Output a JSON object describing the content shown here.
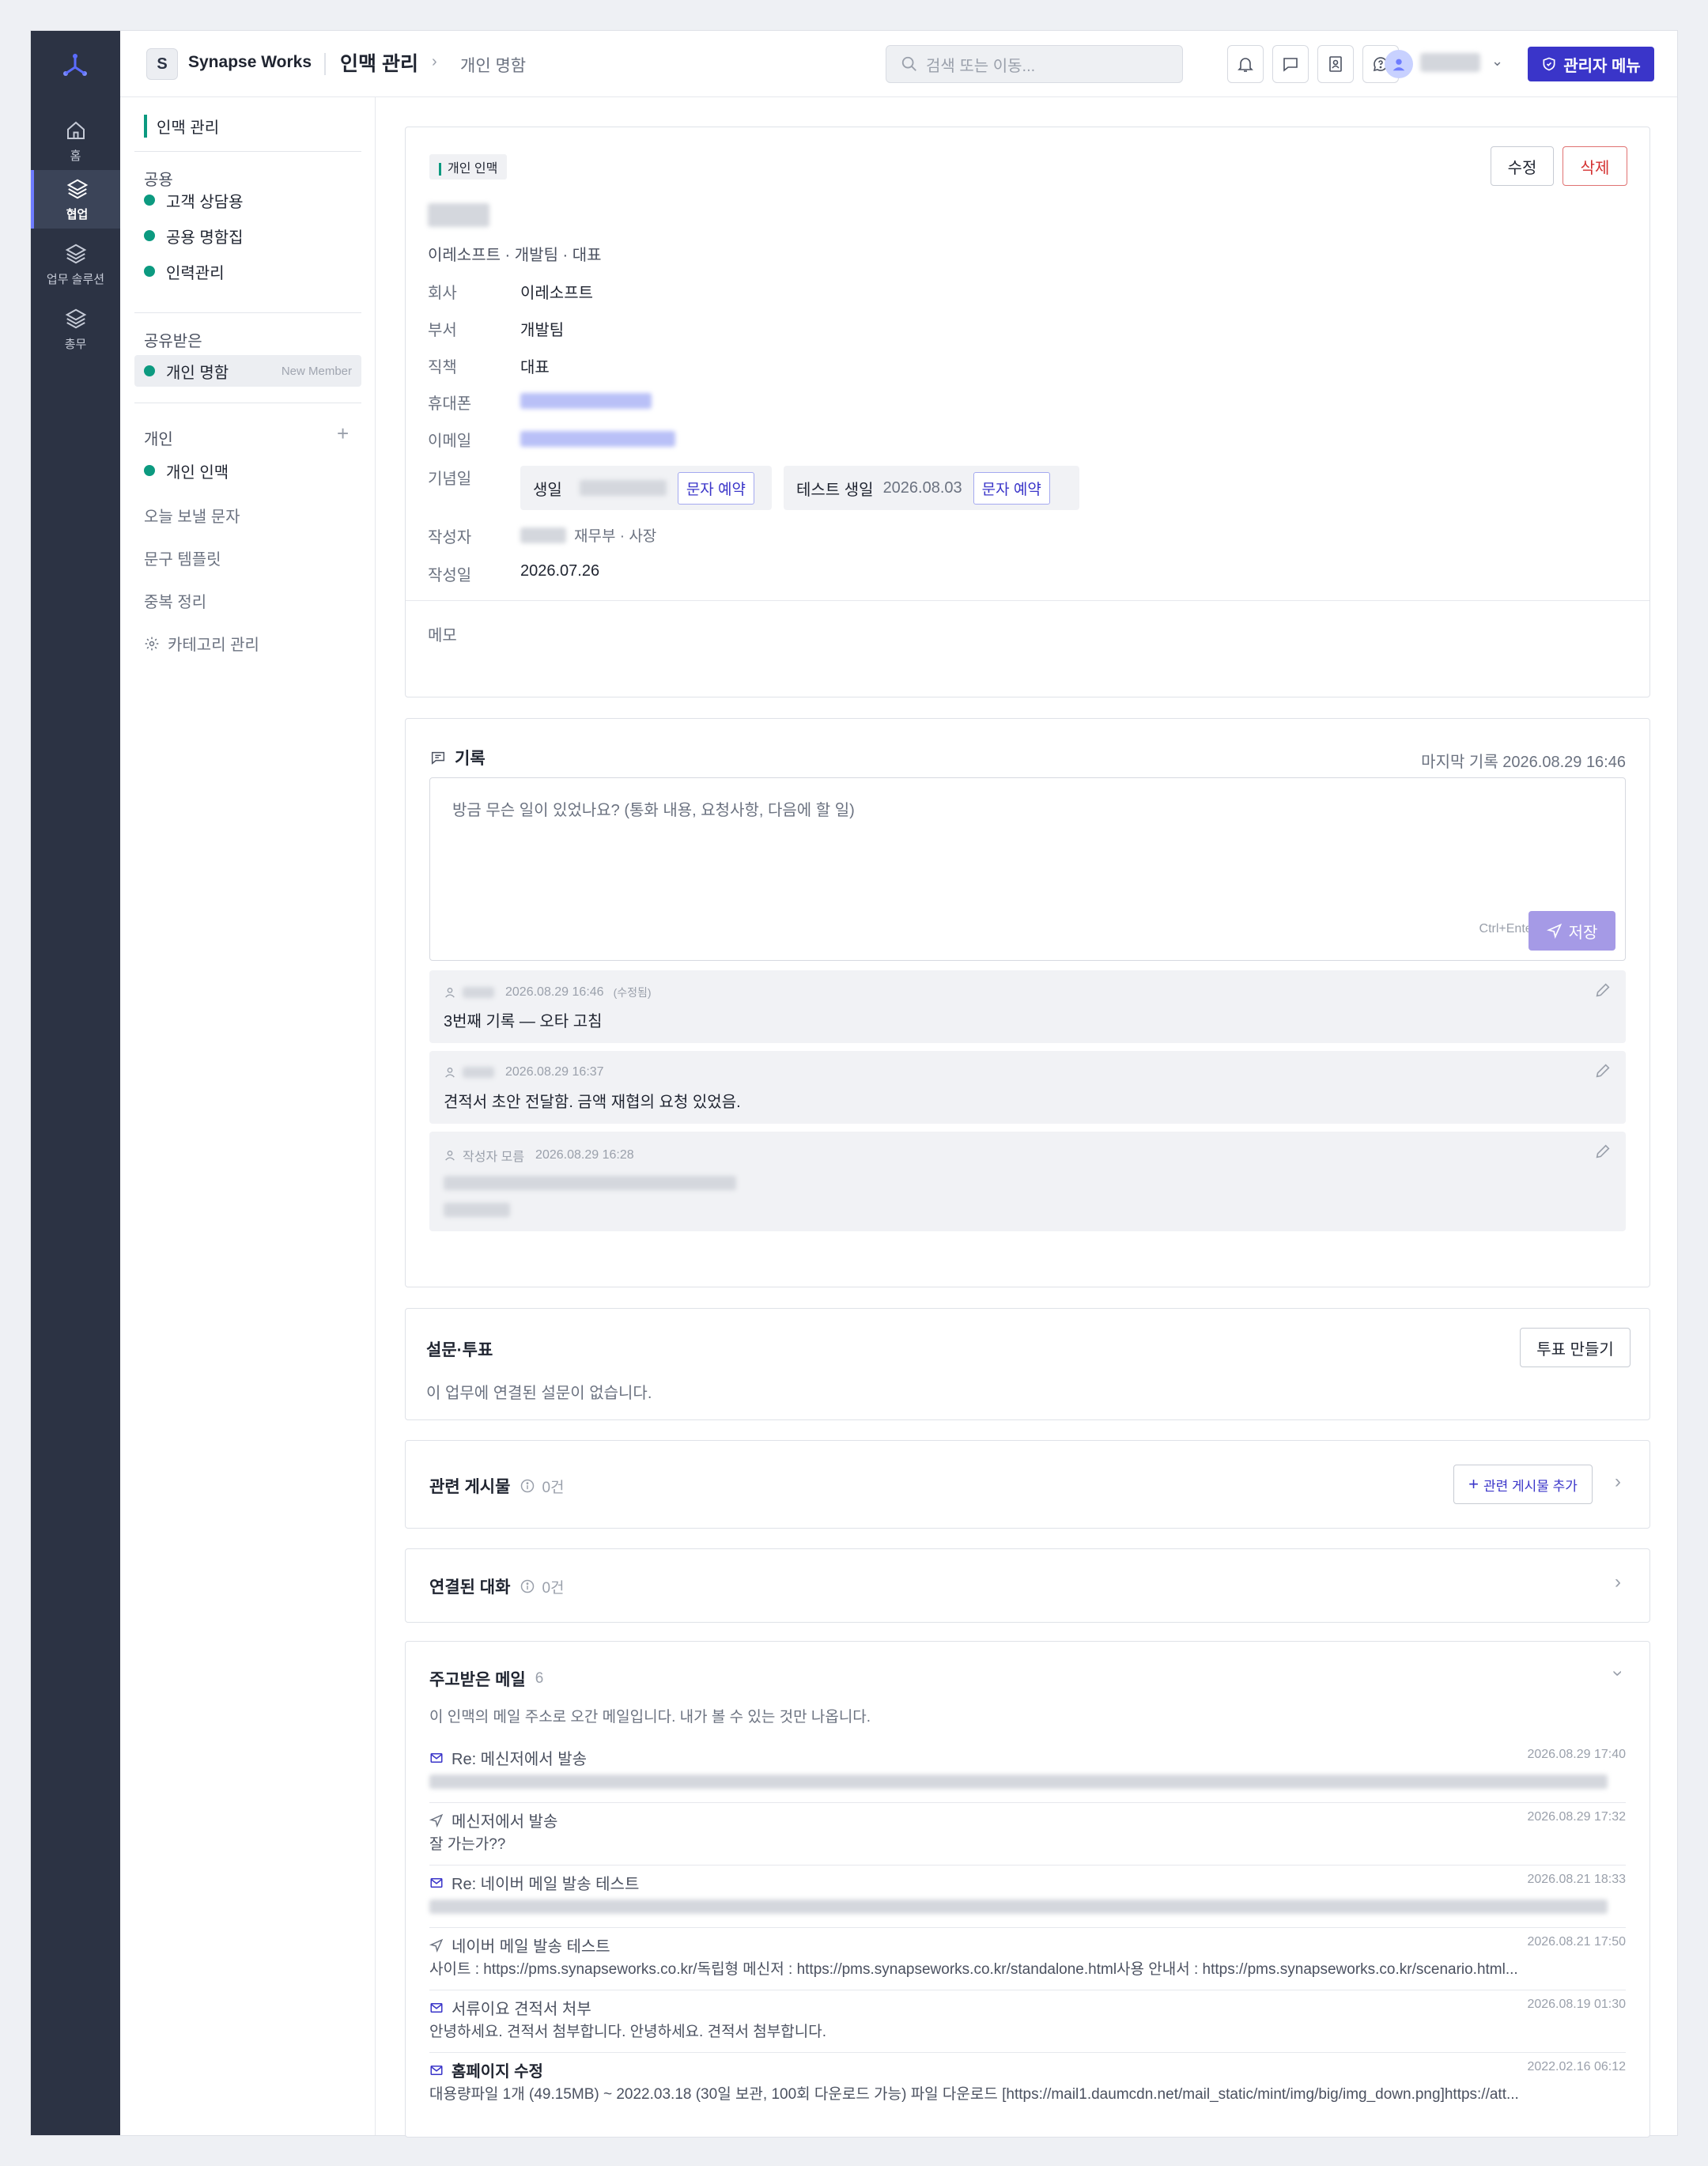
{
  "topbar": {
    "workspace_initial": "S",
    "workspace_name": "Synapse Works",
    "page_title": "인맥 관리",
    "breadcrumb_current": "개인 명함",
    "search_placeholder": "검색 또는 이동...",
    "admin_label": "관리자 메뉴"
  },
  "rail": {
    "items": [
      {
        "label": "홈",
        "icon": "home-icon"
      },
      {
        "label": "협업",
        "icon": "layers-icon"
      },
      {
        "label": "업무 솔루션",
        "icon": "layers-icon"
      },
      {
        "label": "총무",
        "icon": "layers-icon"
      }
    ]
  },
  "sidebar": {
    "header": "인맥 관리",
    "groups": [
      {
        "label": "공용",
        "items": [
          "고객 상담용",
          "공용 명함집",
          "인력관리"
        ]
      },
      {
        "label": "공유받은",
        "items": [
          "개인 명함"
        ],
        "tag": "New Member"
      },
      {
        "label": "개인",
        "items": [
          "개인 인맥"
        ]
      }
    ],
    "links": [
      "오늘 보낼 문자",
      "문구 템플릿",
      "중복 정리",
      "카테고리 관리"
    ]
  },
  "contact": {
    "category": "개인 인맥",
    "edit_label": "수정",
    "delete_label": "삭제",
    "subtitle": "이레소프트 · 개발팀 · 대표",
    "fields": {
      "company_label": "회사",
      "company": "이레소프트",
      "dept_label": "부서",
      "dept": "개발팀",
      "position_label": "직책",
      "position": "대표",
      "phone_label": "휴대폰",
      "email_label": "이메일",
      "anniv_label": "기념일",
      "author_label": "작성자",
      "author_role": "재무부 · 사장",
      "created_label": "작성일",
      "created": "2026.07.26"
    },
    "anniversaries": [
      {
        "name": "생일",
        "date": "",
        "action": "문자 예약"
      },
      {
        "name": "테스트 생일",
        "date": "2026.08.03",
        "action": "문자 예약"
      }
    ],
    "memo_label": "메모"
  },
  "records": {
    "title": "기록",
    "last": "마지막 기록 2026.08.29 16:46",
    "placeholder": "방금 무슨 일이 있었나요? (통화 내용, 요청사항, 다음에 할 일)",
    "hint": "Ctrl+Enter",
    "save": "저장",
    "entries": [
      {
        "author": "",
        "date": "2026.08.29 16:46",
        "note": "(수정됨)",
        "text": "3번째 기록 — 오타 고침"
      },
      {
        "author": "",
        "date": "2026.08.29 16:37",
        "note": "",
        "text": "견적서 초안 전달함. 금액 재협의 요청 있었음."
      },
      {
        "author": "작성자 모름",
        "date": "2026.08.29 16:28",
        "note": "",
        "text": ""
      }
    ]
  },
  "survey": {
    "title": "설문·투표",
    "button": "투표 만들기",
    "empty": "이 업무에 연결된 설문이 없습니다."
  },
  "related": {
    "title": "관련 게시물",
    "count": "0건",
    "add": "관련 게시물 추가"
  },
  "chats": {
    "title": "연결된 대화",
    "count": "0건"
  },
  "mail": {
    "title": "주고받은 메일",
    "count": "6",
    "desc": "이 인맥의 메일 주소로 오간 메일입니다. 내가 볼 수 있는 것만 나옵니다.",
    "items": [
      {
        "icon": "mail-icon",
        "subject": "Re: 메신저에서 발송",
        "date": "2026.08.29 17:40",
        "preview": "",
        "blurred": true
      },
      {
        "icon": "send-icon",
        "subject": "메신저에서 발송",
        "date": "2026.08.29 17:32",
        "preview": "잘 가는가??",
        "blurred": false
      },
      {
        "icon": "mail-icon",
        "subject": "Re: 네이버 메일 발송 테스트",
        "date": "2026.08.21 18:33",
        "preview": "",
        "blurred": true
      },
      {
        "icon": "send-icon",
        "subject": "네이버 메일 발송 테스트",
        "date": "2026.08.21 17:50",
        "preview": "사이트 : https://pms.synapseworks.co.kr/독립형 메신저 : https://pms.synapseworks.co.kr/standalone.html사용 안내서 : https://pms.synapseworks.co.kr/scenario.html...",
        "blurred": false
      },
      {
        "icon": "mail-icon",
        "subject": "서류이요 견적서 처부",
        "date": "2026.08.19 01:30",
        "preview": "안녕하세요. 견적서 첨부합니다. 안녕하세요. 견적서 첨부합니다.",
        "blurred": false
      },
      {
        "icon": "mail-icon",
        "subject": "홈페이지 수정",
        "date": "2022.02.16 06:12",
        "preview": "대용량파일 1개 (49.15MB) ~ 2022.03.18 (30일 보관, 100회 다운로드 가능) 파일 다운로드 [https://mail1.daumcdn.net/mail_static/mint/img/big/img_down.png]https://att...",
        "blurred": false,
        "bold": true
      }
    ]
  }
}
